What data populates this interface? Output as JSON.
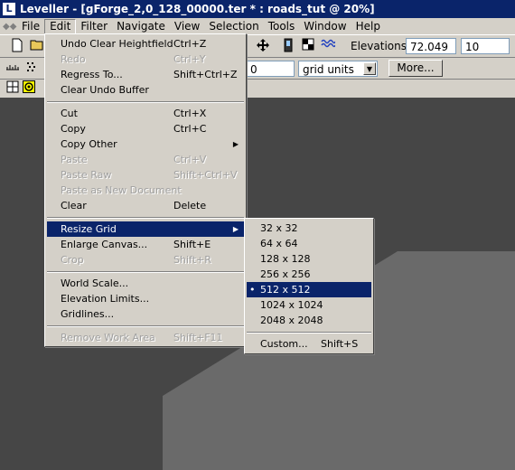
{
  "window": {
    "title": "Leveller - [gForge_2,0_128_00000.ter * : roads_tut @ 20%]"
  },
  "menubar": [
    "File",
    "Edit",
    "Filter",
    "Navigate",
    "View",
    "Selection",
    "Tools",
    "Window",
    "Help"
  ],
  "toolbar": {
    "elevations_label": "Elevations:",
    "elevation_value": "72.049",
    "elevation_step": "10",
    "value_field": "0",
    "units_select": "grid units",
    "more_button": "More..."
  },
  "edit_menu": [
    {
      "label": "Undo Clear Heightfield",
      "shortcut": "Ctrl+Z",
      "enabled": true
    },
    {
      "label": "Redo",
      "shortcut": "Ctrl+Y",
      "enabled": false
    },
    {
      "label": "Regress To...",
      "shortcut": "Shift+Ctrl+Z",
      "enabled": true
    },
    {
      "label": "Clear Undo Buffer",
      "shortcut": "",
      "enabled": true
    },
    {
      "label": "Cut",
      "shortcut": "Ctrl+X",
      "enabled": true
    },
    {
      "label": "Copy",
      "shortcut": "Ctrl+C",
      "enabled": true
    },
    {
      "label": "Copy Other",
      "shortcut": "",
      "enabled": true
    },
    {
      "label": "Paste",
      "shortcut": "Ctrl+V",
      "enabled": false
    },
    {
      "label": "Paste Raw",
      "shortcut": "Shift+Ctrl+V",
      "enabled": false
    },
    {
      "label": "Paste as New Document",
      "shortcut": "",
      "enabled": false
    },
    {
      "label": "Clear",
      "shortcut": "Delete",
      "enabled": true
    },
    {
      "label": "Resize Grid",
      "shortcut": "",
      "enabled": true
    },
    {
      "label": "Enlarge Canvas...",
      "shortcut": "Shift+E",
      "enabled": true
    },
    {
      "label": "Crop",
      "shortcut": "Shift+R",
      "enabled": false
    },
    {
      "label": "World Scale...",
      "shortcut": "",
      "enabled": true
    },
    {
      "label": "Elevation Limits...",
      "shortcut": "",
      "enabled": true
    },
    {
      "label": "Gridlines...",
      "shortcut": "",
      "enabled": true
    },
    {
      "label": "Remove Work Area",
      "shortcut": "Shift+F11",
      "enabled": false
    }
  ],
  "resize_submenu": [
    {
      "label": "32 x 32",
      "shortcut": ""
    },
    {
      "label": "64 x 64",
      "shortcut": ""
    },
    {
      "label": "128 x 128",
      "shortcut": ""
    },
    {
      "label": "256 x 256",
      "shortcut": ""
    },
    {
      "label": "512 x 512",
      "shortcut": "",
      "checked": true
    },
    {
      "label": "1024 x 1024",
      "shortcut": ""
    },
    {
      "label": "2048 x 2048",
      "shortcut": ""
    },
    {
      "label": "Custom...",
      "shortcut": "Shift+S"
    }
  ],
  "icons": {
    "check_bullet": "•",
    "submenu_arrow": "▶",
    "dropdown_arrow": "▼"
  }
}
